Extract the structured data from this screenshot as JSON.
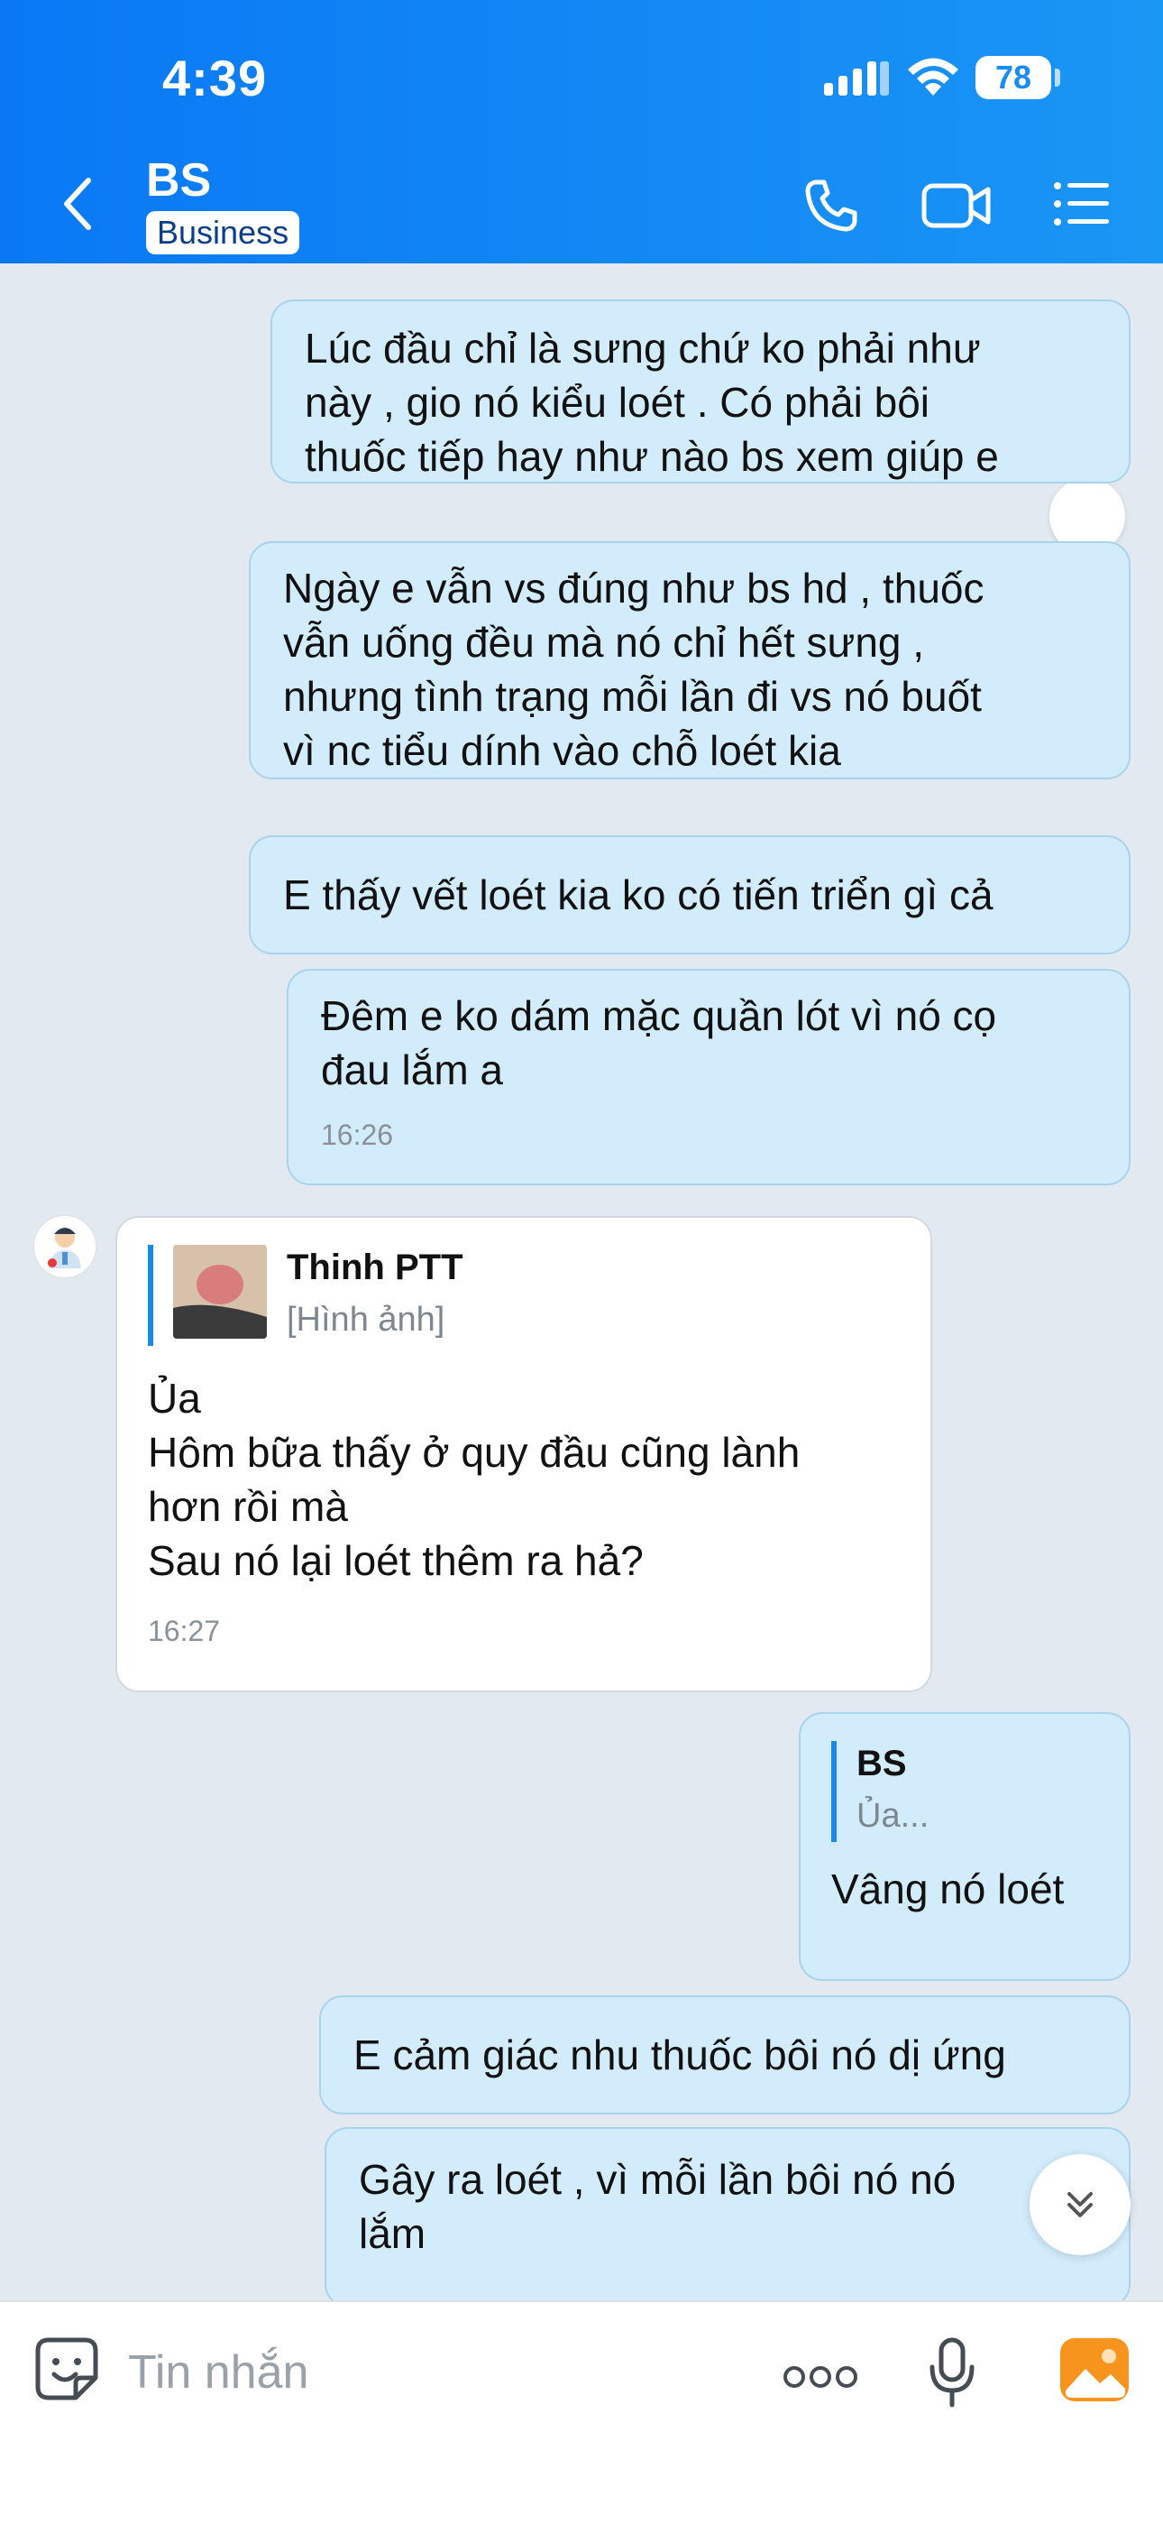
{
  "status_bar": {
    "time": "4:39",
    "battery": "78"
  },
  "header": {
    "title": "BS",
    "badge": "Business"
  },
  "messages": [
    {
      "text": "Lúc đầu chỉ là sưng chứ ko phải như\nnày , gio nó kiểu loét . Có phải bôi\nthuốc tiếp hay như nào bs xem giúp e"
    },
    {
      "text": "Ngày e vẫn vs đúng như bs hd , thuốc\nvẫn uống đều mà nó chỉ hết sưng ,\nnhưng tình trạng mỗi lần đi vs nó buốt\nvì nc tiểu dính vào chỗ loét kia"
    },
    {
      "text": "E thấy vết loét kia ko có tiến triển gì cả"
    },
    {
      "text": "Đêm e ko dám mặc quần lót vì nó cọ\nđau lắm a",
      "time": "16:26"
    },
    {
      "quote_name": "Thinh PTT",
      "quote_sub": "[Hình ảnh]",
      "text": "Ủa\nHôm bữa thấy ở quy đầu cũng lành\nhơn rồi mà\nSau nó lại loét thêm ra hả?",
      "time": "16:27"
    },
    {
      "quote_name": "BS",
      "quote_sub": "Ủa...",
      "text": "Vâng nó loét"
    },
    {
      "text": "E cảm giác nhu thuốc bôi nó dị ứng"
    },
    {
      "text": "Gây ra loét , vì mỗi lần bôi nó nó\nlắm"
    }
  ],
  "input": {
    "placeholder": "Tin nhắn"
  },
  "colors": {
    "header_start": "#0a78f5",
    "header_end": "#1a96f5",
    "outgoing_bubble": "#d2ecfb",
    "incoming_bubble": "#ffffff",
    "chat_bg": "#e2e9f1",
    "accent": "#1e88e5"
  },
  "icons": [
    "back-icon",
    "phone-icon",
    "video-call-icon",
    "list-menu-icon",
    "sticker-icon",
    "more-icon",
    "microphone-icon",
    "gallery-icon",
    "scroll-down-icon"
  ]
}
